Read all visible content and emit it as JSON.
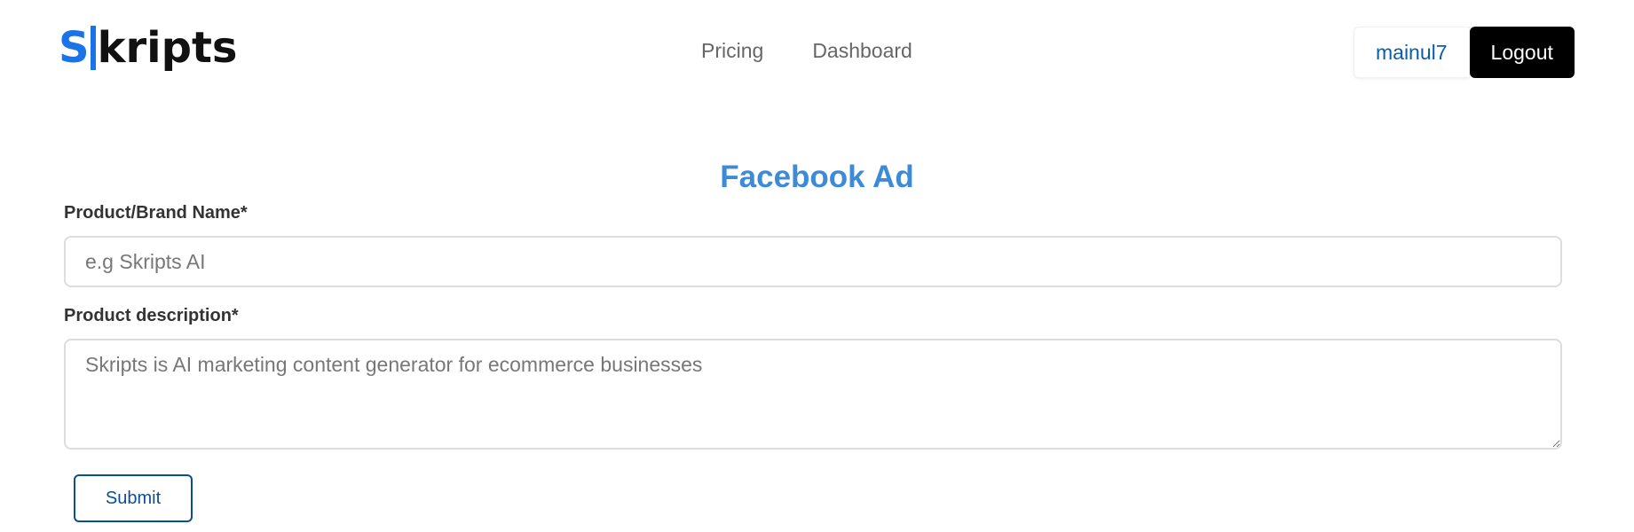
{
  "navbar": {
    "logo": {
      "first_letter": "S",
      "rest": "kripts"
    },
    "links": [
      {
        "label": "Pricing"
      },
      {
        "label": "Dashboard"
      }
    ],
    "username": "mainul7",
    "logout_label": "Logout"
  },
  "page": {
    "title": "Facebook Ad"
  },
  "form": {
    "name": {
      "label": "Product/Brand Name*",
      "value": "",
      "placeholder": "e.g Skripts AI"
    },
    "description": {
      "label": "Product description*",
      "value": "",
      "placeholder": "Skripts is AI marketing content generator for ecommerce businesses"
    },
    "submit_label": "Submit"
  },
  "colors": {
    "brand_blue": "#1a73e8",
    "title_blue": "#3d8ad8",
    "link_blue": "#0b5cad",
    "logout_bg": "#000000"
  }
}
